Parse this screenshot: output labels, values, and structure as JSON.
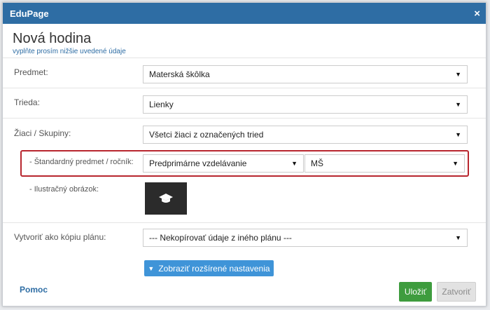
{
  "window": {
    "app_name": "EduPage",
    "close_symbol": "×"
  },
  "form": {
    "title": "Nová hodina",
    "subtitle": "vyplňte prosím nižšie uvedené údaje",
    "subject": {
      "label": "Predmet:",
      "value": "Materská škôlka"
    },
    "class": {
      "label": "Trieda:",
      "value": "Lienky"
    },
    "students": {
      "label": "Žiaci / Skupiny:",
      "value": "Všetci žiaci z označených tried"
    },
    "standard": {
      "label": "- Štandardný predmet / ročník:",
      "subject_value": "Predprimárne vzdelávanie",
      "grade_value": "MŠ"
    },
    "illustration": {
      "label": "- Ilustračný obrázok:",
      "icon": "graduation-cap-icon"
    },
    "copy_plan": {
      "label": "Vytvoriť ako kópiu plánu:",
      "value": "--- Nekopírovať údaje z iného plánu ---"
    },
    "advanced_button": "Zobraziť rozšírené nastavenia"
  },
  "footer": {
    "help_link": "Pomoc",
    "save_label": "Uložiť",
    "close_label": "Zatvoriť"
  },
  "colors": {
    "titlebar": "#2e6da4",
    "highlight": "#b8262e",
    "save": "#3e9c3e",
    "advanced": "#3f94d8"
  }
}
